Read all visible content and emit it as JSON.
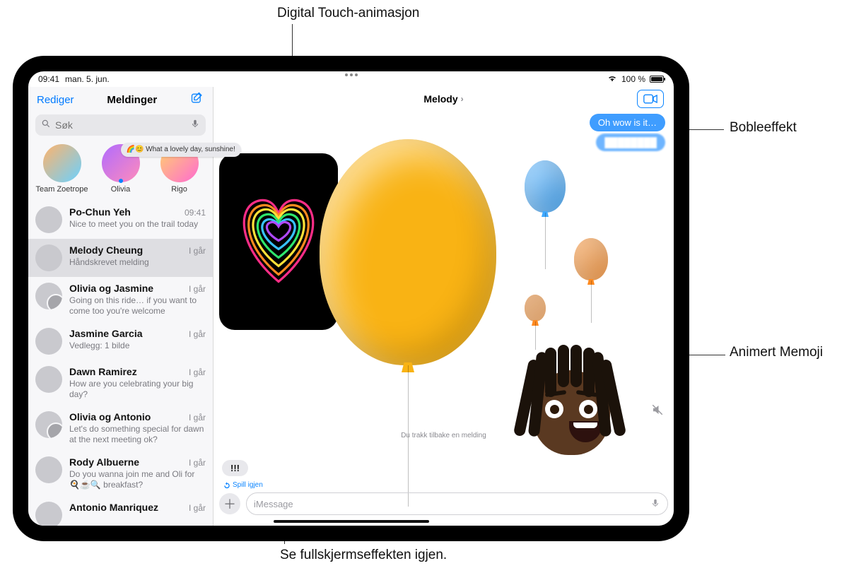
{
  "callouts": {
    "top": "Digital Touch-animasjon",
    "right1": "Bobleeffekt",
    "right2": "Animert Memoji",
    "bottom": "Se fullskjermseffekten igjen."
  },
  "status": {
    "time": "09:41",
    "date": "man. 5. jun.",
    "battery": "100 %"
  },
  "sidebar": {
    "edit": "Rediger",
    "title": "Meldinger",
    "search_placeholder": "Søk",
    "pinned": [
      {
        "name": "Team Zoetrope"
      },
      {
        "name": "Olivia",
        "bubble": "🌈😊 What a lovely day, sunshine!",
        "unread": true
      },
      {
        "name": "Rigo"
      }
    ],
    "convos": [
      {
        "name": "Po-Chun Yeh",
        "time": "09:41",
        "preview": "Nice to meet you on the trail today"
      },
      {
        "name": "Melody Cheung",
        "time": "I går",
        "preview": "Håndskrevet melding",
        "selected": true
      },
      {
        "name": "Olivia og Jasmine",
        "time": "I går",
        "preview": "Going on this ride… if you want to come too you're welcome",
        "duo": true
      },
      {
        "name": "Jasmine Garcia",
        "time": "I går",
        "preview": "Vedlegg: 1 bilde"
      },
      {
        "name": "Dawn Ramirez",
        "time": "I går",
        "preview": "How are you celebrating your big day?"
      },
      {
        "name": "Olivia og Antonio",
        "time": "I går",
        "preview": "Let's do something special for dawn at the next meeting ok?",
        "duo": true
      },
      {
        "name": "Rody Albuerne",
        "time": "I går",
        "preview": "Do you wanna join me and Oli for 🍳☕🔍 breakfast?"
      },
      {
        "name": "Antonio Manriquez",
        "time": "I går",
        "preview": ""
      }
    ]
  },
  "chat": {
    "title": "Melody",
    "sent1": "Oh wow is it…",
    "sent2": "████████",
    "retract": "Du trakk tilbake en melding",
    "reply": "!!!",
    "replay": "Spill igjen",
    "compose_placeholder": "iMessage"
  }
}
